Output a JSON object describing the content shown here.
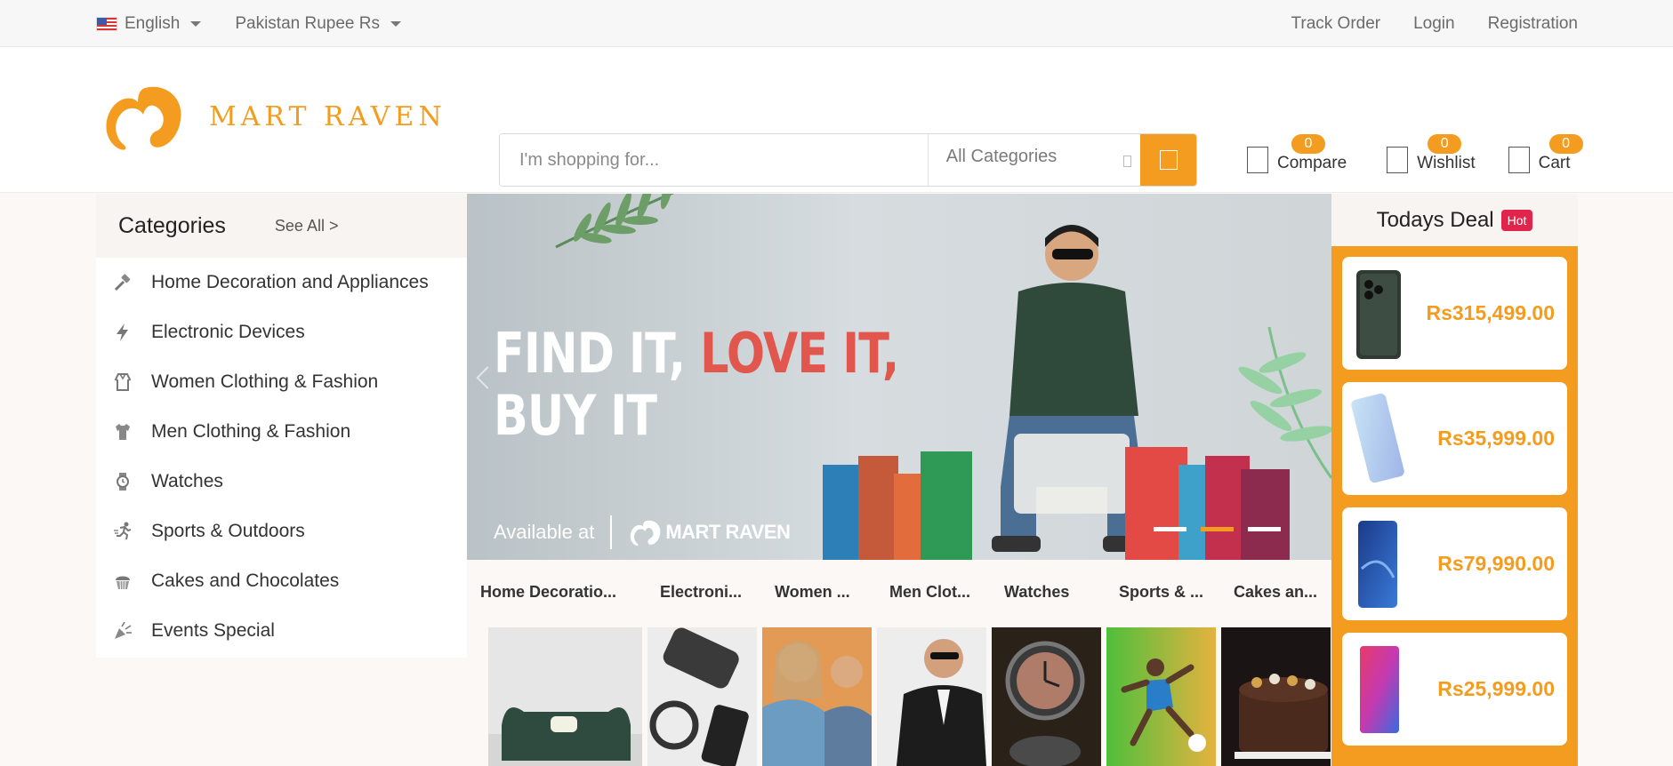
{
  "topbar": {
    "language": "English",
    "currency": "Pakistan Rupee Rs",
    "links": [
      "Track Order",
      "Login",
      "Registration"
    ]
  },
  "brand": {
    "name": "MART RAVEN",
    "accent": "#f39c1f"
  },
  "search": {
    "placeholder": "I'm shopping for...",
    "category": "All Categories"
  },
  "header_icons": {
    "compare": {
      "label": "Compare",
      "count": "0"
    },
    "wishlist": {
      "label": "Wishlist",
      "count": "0"
    },
    "cart": {
      "label": "Cart",
      "count": "0"
    }
  },
  "categories": {
    "title": "Categories",
    "see_all": "See All >",
    "items": [
      {
        "label": "Home Decoration and Appliances",
        "icon": "hammer-icon"
      },
      {
        "label": "Electronic Devices",
        "icon": "lightning-icon"
      },
      {
        "label": "Women Clothing & Fashion",
        "icon": "dress-icon"
      },
      {
        "label": "Men Clothing & Fashion",
        "icon": "shirt-icon"
      },
      {
        "label": "Watches",
        "icon": "watch-icon"
      },
      {
        "label": "Sports & Outdoors",
        "icon": "running-icon"
      },
      {
        "label": "Cakes and Chocolates",
        "icon": "cupcake-icon"
      },
      {
        "label": "Events Special",
        "icon": "party-icon"
      }
    ]
  },
  "hero": {
    "line1_white": "FIND IT, ",
    "line1_red": "LOVE IT,",
    "line2": "BUY IT",
    "available": "Available at",
    "brand": "MART RAVEN",
    "slide_count": 3,
    "active_slide": 2
  },
  "category_tabs": [
    "Home Decoratio...",
    "Electroni...",
    "Women ...",
    "Men Clot...",
    "Watches",
    "Sports & ...",
    "Cakes an..."
  ],
  "todays_deal": {
    "title": "Todays Deal",
    "badge": "Hot",
    "items": [
      {
        "price": "Rs315,499.00"
      },
      {
        "price": "Rs35,999.00"
      },
      {
        "price": "Rs79,990.00"
      },
      {
        "price": "Rs25,999.00"
      }
    ]
  }
}
